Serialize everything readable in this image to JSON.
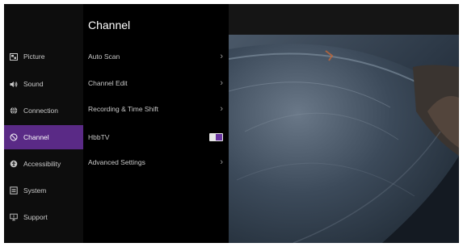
{
  "sidebar": {
    "items": [
      {
        "label": "Picture",
        "icon": "picture-icon"
      },
      {
        "label": "Sound",
        "icon": "speaker-icon"
      },
      {
        "label": "Connection",
        "icon": "globe-icon"
      },
      {
        "label": "Channel",
        "icon": "channel-icon"
      },
      {
        "label": "Accessibility",
        "icon": "accessibility-icon"
      },
      {
        "label": "System",
        "icon": "system-icon"
      },
      {
        "label": "Support",
        "icon": "support-icon"
      }
    ],
    "active_index": 3
  },
  "menu": {
    "title": "Channel",
    "items": [
      {
        "label": "Auto Scan",
        "control": "chevron"
      },
      {
        "label": "Channel Edit",
        "control": "chevron"
      },
      {
        "label": "Recording & Time Shift",
        "control": "chevron"
      },
      {
        "label": "HbbTV",
        "control": "toggle",
        "toggle_on": true
      },
      {
        "label": "Advanced Settings",
        "control": "chevron"
      }
    ]
  },
  "colors": {
    "accent": "#5a2a86",
    "toggle_knob": "#6a34a0",
    "background": "#000000"
  }
}
